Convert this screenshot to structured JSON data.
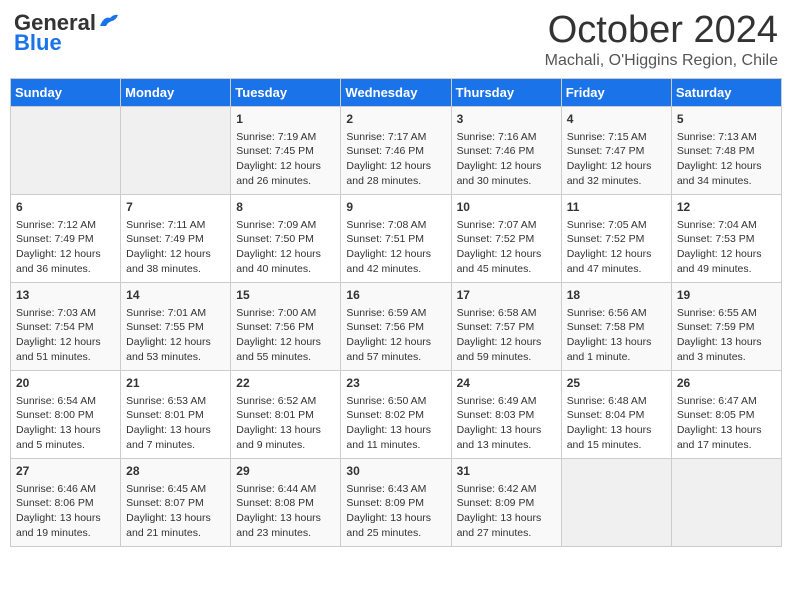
{
  "header": {
    "logo_general": "General",
    "logo_blue": "Blue",
    "month": "October 2024",
    "location": "Machali, O'Higgins Region, Chile"
  },
  "days_of_week": [
    "Sunday",
    "Monday",
    "Tuesday",
    "Wednesday",
    "Thursday",
    "Friday",
    "Saturday"
  ],
  "weeks": [
    [
      {
        "num": "",
        "info": ""
      },
      {
        "num": "",
        "info": ""
      },
      {
        "num": "1",
        "info": "Sunrise: 7:19 AM\nSunset: 7:45 PM\nDaylight: 12 hours and 26 minutes."
      },
      {
        "num": "2",
        "info": "Sunrise: 7:17 AM\nSunset: 7:46 PM\nDaylight: 12 hours and 28 minutes."
      },
      {
        "num": "3",
        "info": "Sunrise: 7:16 AM\nSunset: 7:46 PM\nDaylight: 12 hours and 30 minutes."
      },
      {
        "num": "4",
        "info": "Sunrise: 7:15 AM\nSunset: 7:47 PM\nDaylight: 12 hours and 32 minutes."
      },
      {
        "num": "5",
        "info": "Sunrise: 7:13 AM\nSunset: 7:48 PM\nDaylight: 12 hours and 34 minutes."
      }
    ],
    [
      {
        "num": "6",
        "info": "Sunrise: 7:12 AM\nSunset: 7:49 PM\nDaylight: 12 hours and 36 minutes."
      },
      {
        "num": "7",
        "info": "Sunrise: 7:11 AM\nSunset: 7:49 PM\nDaylight: 12 hours and 38 minutes."
      },
      {
        "num": "8",
        "info": "Sunrise: 7:09 AM\nSunset: 7:50 PM\nDaylight: 12 hours and 40 minutes."
      },
      {
        "num": "9",
        "info": "Sunrise: 7:08 AM\nSunset: 7:51 PM\nDaylight: 12 hours and 42 minutes."
      },
      {
        "num": "10",
        "info": "Sunrise: 7:07 AM\nSunset: 7:52 PM\nDaylight: 12 hours and 45 minutes."
      },
      {
        "num": "11",
        "info": "Sunrise: 7:05 AM\nSunset: 7:52 PM\nDaylight: 12 hours and 47 minutes."
      },
      {
        "num": "12",
        "info": "Sunrise: 7:04 AM\nSunset: 7:53 PM\nDaylight: 12 hours and 49 minutes."
      }
    ],
    [
      {
        "num": "13",
        "info": "Sunrise: 7:03 AM\nSunset: 7:54 PM\nDaylight: 12 hours and 51 minutes."
      },
      {
        "num": "14",
        "info": "Sunrise: 7:01 AM\nSunset: 7:55 PM\nDaylight: 12 hours and 53 minutes."
      },
      {
        "num": "15",
        "info": "Sunrise: 7:00 AM\nSunset: 7:56 PM\nDaylight: 12 hours and 55 minutes."
      },
      {
        "num": "16",
        "info": "Sunrise: 6:59 AM\nSunset: 7:56 PM\nDaylight: 12 hours and 57 minutes."
      },
      {
        "num": "17",
        "info": "Sunrise: 6:58 AM\nSunset: 7:57 PM\nDaylight: 12 hours and 59 minutes."
      },
      {
        "num": "18",
        "info": "Sunrise: 6:56 AM\nSunset: 7:58 PM\nDaylight: 13 hours and 1 minute."
      },
      {
        "num": "19",
        "info": "Sunrise: 6:55 AM\nSunset: 7:59 PM\nDaylight: 13 hours and 3 minutes."
      }
    ],
    [
      {
        "num": "20",
        "info": "Sunrise: 6:54 AM\nSunset: 8:00 PM\nDaylight: 13 hours and 5 minutes."
      },
      {
        "num": "21",
        "info": "Sunrise: 6:53 AM\nSunset: 8:01 PM\nDaylight: 13 hours and 7 minutes."
      },
      {
        "num": "22",
        "info": "Sunrise: 6:52 AM\nSunset: 8:01 PM\nDaylight: 13 hours and 9 minutes."
      },
      {
        "num": "23",
        "info": "Sunrise: 6:50 AM\nSunset: 8:02 PM\nDaylight: 13 hours and 11 minutes."
      },
      {
        "num": "24",
        "info": "Sunrise: 6:49 AM\nSunset: 8:03 PM\nDaylight: 13 hours and 13 minutes."
      },
      {
        "num": "25",
        "info": "Sunrise: 6:48 AM\nSunset: 8:04 PM\nDaylight: 13 hours and 15 minutes."
      },
      {
        "num": "26",
        "info": "Sunrise: 6:47 AM\nSunset: 8:05 PM\nDaylight: 13 hours and 17 minutes."
      }
    ],
    [
      {
        "num": "27",
        "info": "Sunrise: 6:46 AM\nSunset: 8:06 PM\nDaylight: 13 hours and 19 minutes."
      },
      {
        "num": "28",
        "info": "Sunrise: 6:45 AM\nSunset: 8:07 PM\nDaylight: 13 hours and 21 minutes."
      },
      {
        "num": "29",
        "info": "Sunrise: 6:44 AM\nSunset: 8:08 PM\nDaylight: 13 hours and 23 minutes."
      },
      {
        "num": "30",
        "info": "Sunrise: 6:43 AM\nSunset: 8:09 PM\nDaylight: 13 hours and 25 minutes."
      },
      {
        "num": "31",
        "info": "Sunrise: 6:42 AM\nSunset: 8:09 PM\nDaylight: 13 hours and 27 minutes."
      },
      {
        "num": "",
        "info": ""
      },
      {
        "num": "",
        "info": ""
      }
    ]
  ]
}
